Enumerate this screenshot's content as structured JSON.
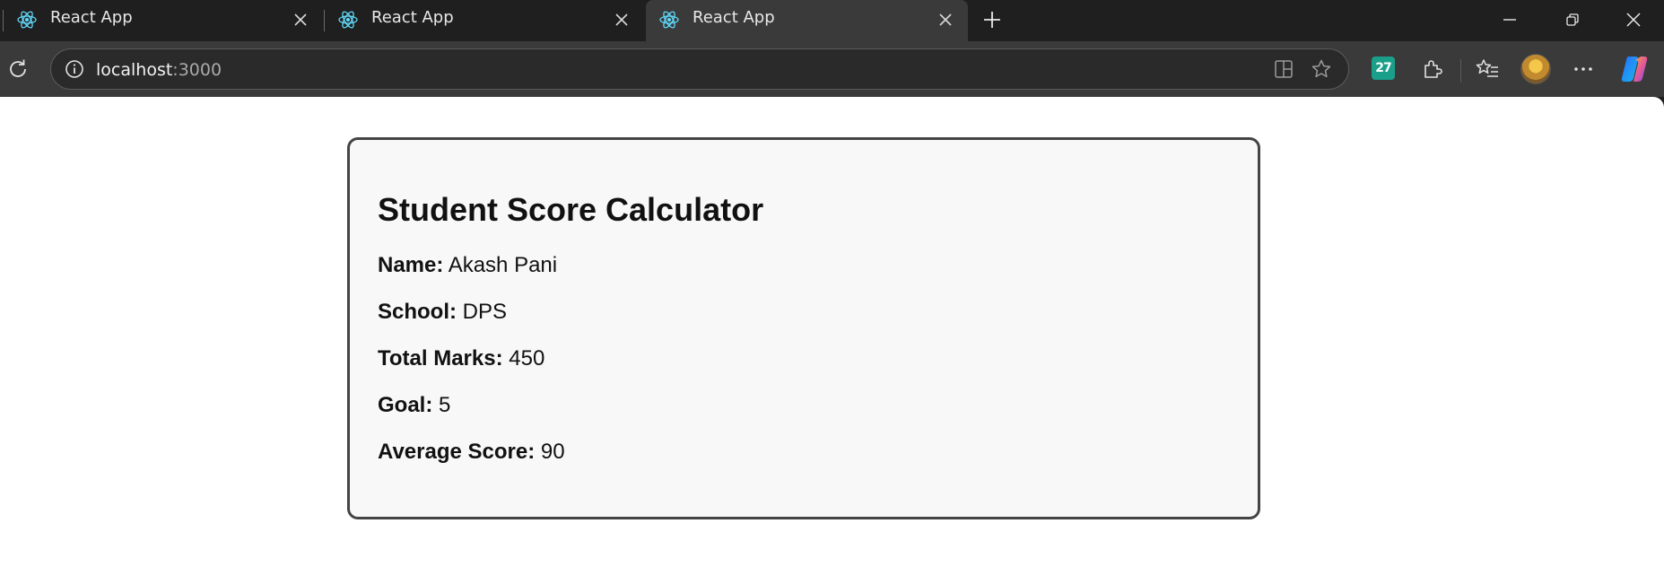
{
  "browser": {
    "tabs": [
      {
        "label": "React App",
        "active": false
      },
      {
        "label": "React App",
        "active": false
      },
      {
        "label": "React App",
        "active": true
      }
    ],
    "address": {
      "host": "localhost",
      "port": ":3000"
    },
    "extension_badge": "27",
    "icons": {
      "tab_favicon": "react-logo-icon",
      "reload": "reload-icon",
      "site_info": "info-icon",
      "split_screen": "split-screen-icon",
      "favorite": "star-icon",
      "extensions": "puzzle-icon",
      "favorites_list": "favorites-icon",
      "menu": "more-icon",
      "copilot": "copilot-icon"
    },
    "colors": {
      "tab_bg": "#1f1f1f",
      "toolbar_bg": "#3a3a3a",
      "react_blue": "#61dafb"
    }
  },
  "app": {
    "title": "Student Score Calculator",
    "fields": [
      {
        "label": "Name:",
        "value": "Akash Pani"
      },
      {
        "label": "School:",
        "value": "DPS"
      },
      {
        "label": "Total Marks:",
        "value": "450"
      },
      {
        "label": "Goal:",
        "value": "5"
      },
      {
        "label": "Average Score:",
        "value": "90"
      }
    ]
  }
}
